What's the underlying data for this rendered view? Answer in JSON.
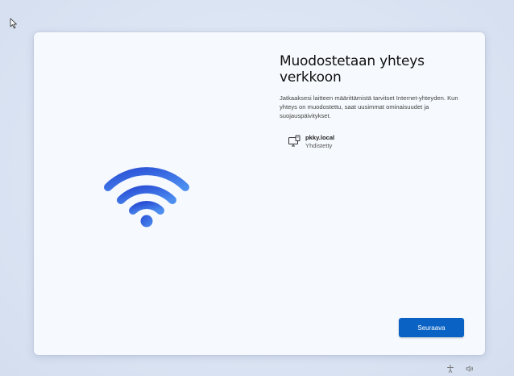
{
  "setup": {
    "title": "Muodostetaan yhteys verkkoon",
    "description": "Jatkaaksesi laitteen määrittämistä tarvitset Internet-yhteyden. Kun yhteys on muodostettu, saat uusimmat ominaisuudet ja suojauspäivitykset.",
    "network": {
      "name": "pkky.local",
      "status": "Yhdistetty",
      "icon": "network-computer-icon"
    },
    "next_label": "Seuraava",
    "hero_icon": "wifi-icon"
  },
  "tray": {
    "icons": [
      "accessibility-icon",
      "volume-icon"
    ]
  },
  "colors": {
    "accent": "#0a63c4",
    "wifi_gradient_start": "#2a4fd6",
    "wifi_gradient_end": "#4c8ef0",
    "card_background": "#f6f9fd"
  }
}
